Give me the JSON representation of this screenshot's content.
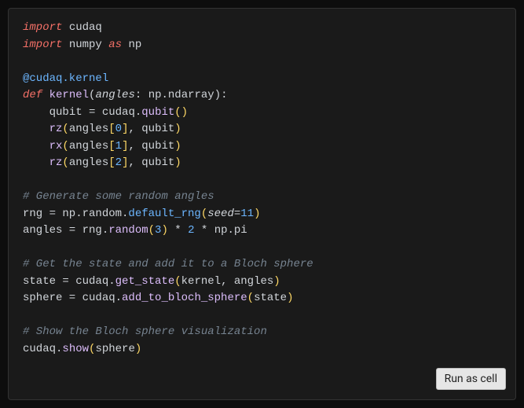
{
  "button": {
    "run_label": "Run as cell"
  },
  "code": {
    "import1_kw": "import",
    "import1_mod": "cudaq",
    "import2_kw": "import",
    "import2_mod": "numpy",
    "import2_as": "as",
    "import2_alias": "np",
    "decorator": "@cudaq.kernel",
    "def_kw": "def",
    "def_name": "kernel",
    "def_param": "angles",
    "def_anno": "np.ndarray",
    "l_qubit_var": "qubit",
    "l_qubit_eq": " = ",
    "l_qubit_mod": "cudaq.",
    "l_qubit_fn": "qubit",
    "rz0_fn": "rz",
    "rz0_arr": "angles",
    "rz0_idx": "0",
    "rz0_arg2": "qubit",
    "rx1_fn": "rx",
    "rx1_arr": "angles",
    "rx1_idx": "1",
    "rx1_arg2": "qubit",
    "rz2_fn": "rz",
    "rz2_arr": "angles",
    "rz2_idx": "2",
    "rz2_arg2": "qubit",
    "cmt1": "# Generate some random angles",
    "rng_lhs": "rng = np.random.",
    "rng_fn": "default_rng",
    "rng_seed_kw": "seed",
    "rng_seed_val": "11",
    "ang_lhs": "angles = rng.",
    "ang_fn": "random",
    "ang_arg": "3",
    "ang_mul": " * ",
    "ang_two": "2",
    "ang_pi": " * np.pi",
    "cmt2": "# Get the state and add it to a Bloch sphere",
    "state_lhs": "state = cudaq.",
    "state_fn": "get_state",
    "state_args": "kernel, angles",
    "sphere_lhs": "sphere = cudaq.",
    "sphere_fn": "add_to_bloch_sphere",
    "sphere_arg": "state",
    "cmt3": "# Show the Bloch sphere visualization",
    "show_mod": "cudaq.",
    "show_fn": "show",
    "show_arg": "sphere"
  }
}
